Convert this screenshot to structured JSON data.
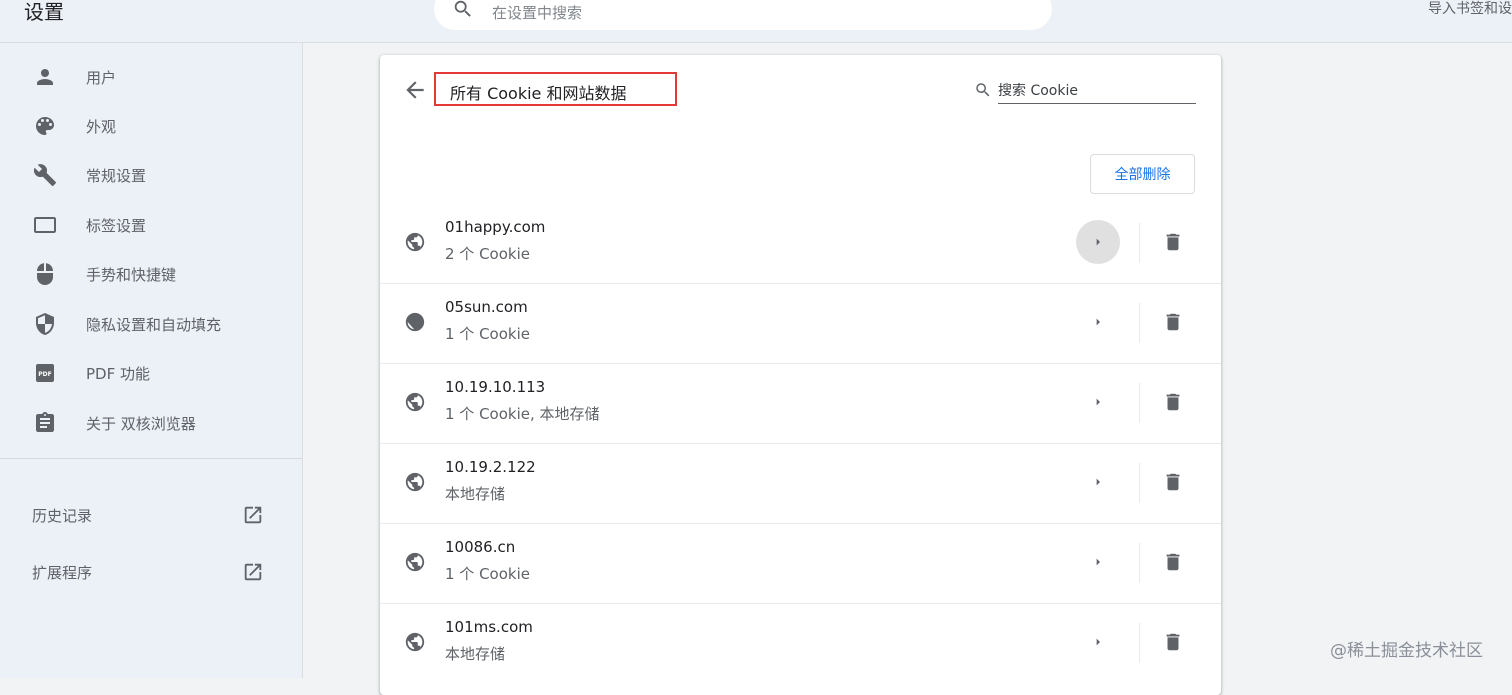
{
  "header": {
    "title": "设置",
    "search_placeholder": "在设置中搜索",
    "import_link": "导入书签和设置"
  },
  "sidebar": {
    "items": [
      {
        "label": "用户",
        "icon": "person-icon"
      },
      {
        "label": "外观",
        "icon": "palette-icon"
      },
      {
        "label": "常规设置",
        "icon": "wrench-icon"
      },
      {
        "label": "标签设置",
        "icon": "tab-icon"
      },
      {
        "label": "手势和快捷键",
        "icon": "mouse-icon"
      },
      {
        "label": "隐私设置和自动填充",
        "icon": "shield-icon"
      },
      {
        "label": "PDF 功能",
        "icon": "pdf-icon"
      },
      {
        "label": "关于 双核浏览器",
        "icon": "clipboard-icon"
      }
    ],
    "external": [
      {
        "label": "历史记录",
        "icon": "open-in-new-icon"
      },
      {
        "label": "扩展程序",
        "icon": "open-in-new-icon"
      }
    ]
  },
  "main": {
    "title": "所有 Cookie 和网站数据",
    "search_placeholder": "搜索 Cookie",
    "remove_all": "全部删除",
    "sites": [
      {
        "name": "01happy.com",
        "info": "2 个 Cookie"
      },
      {
        "name": "05sun.com",
        "info": "1 个 Cookie"
      },
      {
        "name": "10.19.10.113",
        "info": "1 个 Cookie, 本地存储"
      },
      {
        "name": "10.19.2.122",
        "info": "本地存储"
      },
      {
        "name": "10086.cn",
        "info": "1 个 Cookie"
      },
      {
        "name": "101ms.com",
        "info": "本地存储"
      }
    ]
  },
  "watermark": "@稀土掘金技术社区",
  "colors": {
    "accent": "#1a73e8",
    "highlight_border": "#e53935",
    "sidebar_bg": "#ecf0f7",
    "page_bg": "#f1f3f4"
  }
}
